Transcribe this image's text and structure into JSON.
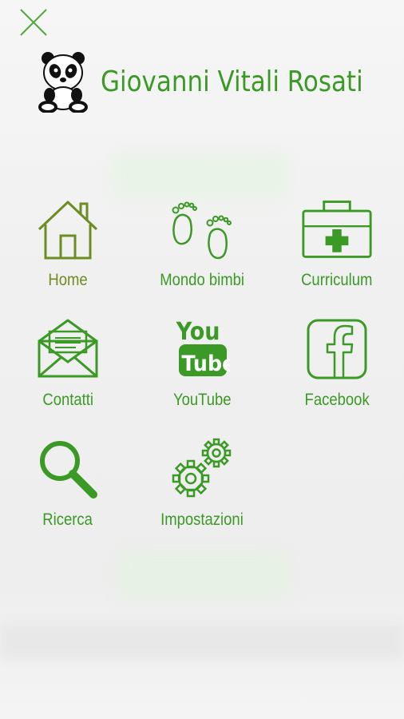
{
  "header": {
    "title": "Giovanni Vitali Rosati",
    "close_icon": "close-icon",
    "avatar_icon": "panda-icon"
  },
  "colors": {
    "accent": "#3a9a25",
    "home": "#6b8e23",
    "background": "#f2f2f2"
  },
  "menu": {
    "items": [
      {
        "label": "Home",
        "icon": "home-icon"
      },
      {
        "label": "Mondo bimbi",
        "icon": "footprints-icon"
      },
      {
        "label": "Curriculum",
        "icon": "first-aid-kit-icon"
      },
      {
        "label": "Contatti",
        "icon": "envelope-icon"
      },
      {
        "label": "YouTube",
        "icon": "youtube-icon"
      },
      {
        "label": "Facebook",
        "icon": "facebook-icon"
      },
      {
        "label": "Ricerca",
        "icon": "magnifier-icon"
      },
      {
        "label": "Impostazioni",
        "icon": "gears-icon"
      }
    ]
  }
}
